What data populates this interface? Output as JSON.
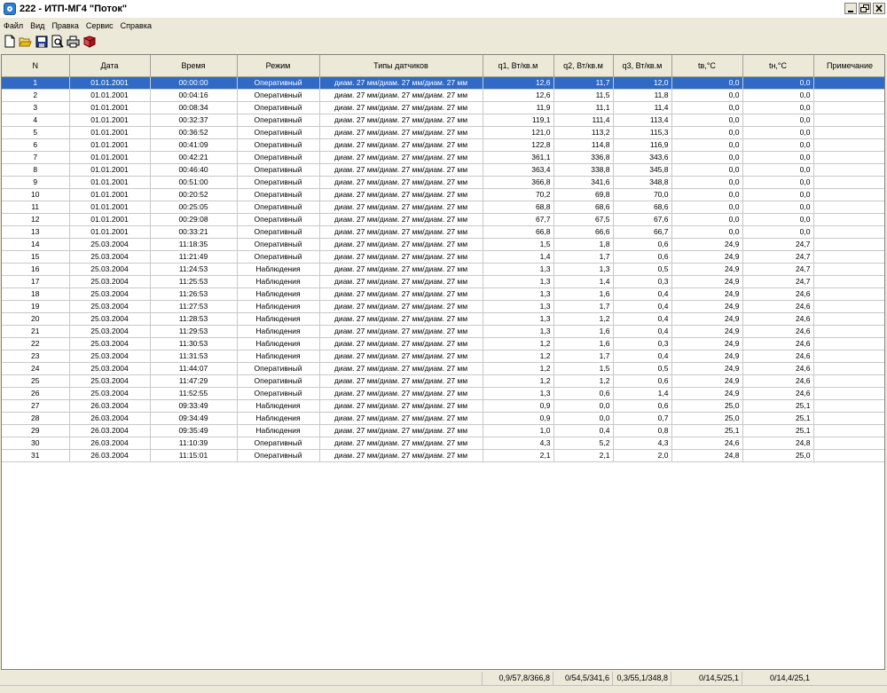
{
  "window": {
    "title": "222 - ИТП-МГ4 \"Поток\""
  },
  "menu": [
    "Файл",
    "Вид",
    "Правка",
    "Сервис",
    "Справка"
  ],
  "toolbar": [
    {
      "name": "new-document-icon"
    },
    {
      "name": "open-folder-icon"
    },
    {
      "name": "save-icon"
    },
    {
      "name": "print-preview-icon"
    },
    {
      "name": "print-icon"
    },
    {
      "name": "help-book-icon"
    }
  ],
  "table": {
    "columns": [
      "N",
      "Дата",
      "Время",
      "Режим",
      "Типы датчиков",
      "q1, Вт/кв.м",
      "q2, Вт/кв.м",
      "q3, Вт/кв.м",
      "tв,°C",
      "tн,°C",
      "Примечание"
    ],
    "selected_row": 0,
    "rows": [
      [
        "1",
        "01.01.2001",
        "00:00:00",
        "Оперативный",
        "диам. 27 мм/диам. 27 мм/диам. 27 мм",
        "12,6",
        "11,7",
        "12,0",
        "0,0",
        "0,0",
        ""
      ],
      [
        "2",
        "01.01.2001",
        "00:04:16",
        "Оперативный",
        "диам. 27 мм/диам. 27 мм/диам. 27 мм",
        "12,6",
        "11,5",
        "11,8",
        "0,0",
        "0,0",
        ""
      ],
      [
        "3",
        "01.01.2001",
        "00:08:34",
        "Оперативный",
        "диам. 27 мм/диам. 27 мм/диам. 27 мм",
        "11,9",
        "11,1",
        "11,4",
        "0,0",
        "0,0",
        ""
      ],
      [
        "4",
        "01.01.2001",
        "00:32:37",
        "Оперативный",
        "диам. 27 мм/диам. 27 мм/диам. 27 мм",
        "119,1",
        "111,4",
        "113,4",
        "0,0",
        "0,0",
        ""
      ],
      [
        "5",
        "01.01.2001",
        "00:36:52",
        "Оперативный",
        "диам. 27 мм/диам. 27 мм/диам. 27 мм",
        "121,0",
        "113,2",
        "115,3",
        "0,0",
        "0,0",
        ""
      ],
      [
        "6",
        "01.01.2001",
        "00:41:09",
        "Оперативный",
        "диам. 27 мм/диам. 27 мм/диам. 27 мм",
        "122,8",
        "114,8",
        "116,9",
        "0,0",
        "0,0",
        ""
      ],
      [
        "7",
        "01.01.2001",
        "00:42:21",
        "Оперативный",
        "диам. 27 мм/диам. 27 мм/диам. 27 мм",
        "361,1",
        "336,8",
        "343,6",
        "0,0",
        "0,0",
        ""
      ],
      [
        "8",
        "01.01.2001",
        "00:46:40",
        "Оперативный",
        "диам. 27 мм/диам. 27 мм/диам. 27 мм",
        "363,4",
        "338,8",
        "345,8",
        "0,0",
        "0,0",
        ""
      ],
      [
        "9",
        "01.01.2001",
        "00:51:00",
        "Оперативный",
        "диам. 27 мм/диам. 27 мм/диам. 27 мм",
        "366,8",
        "341,6",
        "348,8",
        "0,0",
        "0,0",
        ""
      ],
      [
        "10",
        "01.01.2001",
        "00:20:52",
        "Оперативный",
        "диам. 27 мм/диам. 27 мм/диам. 27 мм",
        "70,2",
        "69,8",
        "70,0",
        "0,0",
        "0,0",
        ""
      ],
      [
        "11",
        "01.01.2001",
        "00:25:05",
        "Оперативный",
        "диам. 27 мм/диам. 27 мм/диам. 27 мм",
        "68,8",
        "68,6",
        "68,6",
        "0,0",
        "0,0",
        ""
      ],
      [
        "12",
        "01.01.2001",
        "00:29:08",
        "Оперативный",
        "диам. 27 мм/диам. 27 мм/диам. 27 мм",
        "67,7",
        "67,5",
        "67,6",
        "0,0",
        "0,0",
        ""
      ],
      [
        "13",
        "01.01.2001",
        "00:33:21",
        "Оперативный",
        "диам. 27 мм/диам. 27 мм/диам. 27 мм",
        "66,8",
        "66,6",
        "66,7",
        "0,0",
        "0,0",
        ""
      ],
      [
        "14",
        "25.03.2004",
        "11:18:35",
        "Оперативный",
        "диам. 27 мм/диам. 27 мм/диам. 27 мм",
        "1,5",
        "1,8",
        "0,6",
        "24,9",
        "24,7",
        ""
      ],
      [
        "15",
        "25.03.2004",
        "11:21:49",
        "Оперативный",
        "диам. 27 мм/диам. 27 мм/диам. 27 мм",
        "1,4",
        "1,7",
        "0,6",
        "24,9",
        "24,7",
        ""
      ],
      [
        "16",
        "25.03.2004",
        "11:24:53",
        "Наблюдения",
        "диам. 27 мм/диам. 27 мм/диам. 27 мм",
        "1,3",
        "1,3",
        "0,5",
        "24,9",
        "24,7",
        ""
      ],
      [
        "17",
        "25.03.2004",
        "11:25:53",
        "Наблюдения",
        "диам. 27 мм/диам. 27 мм/диам. 27 мм",
        "1,3",
        "1,4",
        "0,3",
        "24,9",
        "24,7",
        ""
      ],
      [
        "18",
        "25.03.2004",
        "11:26:53",
        "Наблюдения",
        "диам. 27 мм/диам. 27 мм/диам. 27 мм",
        "1,3",
        "1,6",
        "0,4",
        "24,9",
        "24,6",
        ""
      ],
      [
        "19",
        "25.03.2004",
        "11:27:53",
        "Наблюдения",
        "диам. 27 мм/диам. 27 мм/диам. 27 мм",
        "1,3",
        "1,7",
        "0,4",
        "24,9",
        "24,6",
        ""
      ],
      [
        "20",
        "25.03.2004",
        "11:28:53",
        "Наблюдения",
        "диам. 27 мм/диам. 27 мм/диам. 27 мм",
        "1,3",
        "1,2",
        "0,4",
        "24,9",
        "24,6",
        ""
      ],
      [
        "21",
        "25.03.2004",
        "11:29:53",
        "Наблюдения",
        "диам. 27 мм/диам. 27 мм/диам. 27 мм",
        "1,3",
        "1,6",
        "0,4",
        "24,9",
        "24,6",
        ""
      ],
      [
        "22",
        "25.03.2004",
        "11:30:53",
        "Наблюдения",
        "диам. 27 мм/диам. 27 мм/диам. 27 мм",
        "1,2",
        "1,6",
        "0,3",
        "24,9",
        "24,6",
        ""
      ],
      [
        "23",
        "25.03.2004",
        "11:31:53",
        "Наблюдения",
        "диам. 27 мм/диам. 27 мм/диам. 27 мм",
        "1,2",
        "1,7",
        "0,4",
        "24,9",
        "24,6",
        ""
      ],
      [
        "24",
        "25.03.2004",
        "11:44:07",
        "Оперативный",
        "диам. 27 мм/диам. 27 мм/диам. 27 мм",
        "1,2",
        "1,5",
        "0,5",
        "24,9",
        "24,6",
        ""
      ],
      [
        "25",
        "25.03.2004",
        "11:47:29",
        "Оперативный",
        "диам. 27 мм/диам. 27 мм/диам. 27 мм",
        "1,2",
        "1,2",
        "0,6",
        "24,9",
        "24,6",
        ""
      ],
      [
        "26",
        "25.03.2004",
        "11:52:55",
        "Оперативный",
        "диам. 27 мм/диам. 27 мм/диам. 27 мм",
        "1,3",
        "0,6",
        "1,4",
        "24,9",
        "24,6",
        ""
      ],
      [
        "27",
        "26.03.2004",
        "09:33:49",
        "Наблюдения",
        "диам. 27 мм/диам. 27 мм/диам. 27 мм",
        "0,9",
        "0,0",
        "0,6",
        "25,0",
        "25,1",
        ""
      ],
      [
        "28",
        "26.03.2004",
        "09:34:49",
        "Наблюдения",
        "диам. 27 мм/диам. 27 мм/диам. 27 мм",
        "0,9",
        "0,0",
        "0,7",
        "25,0",
        "25,1",
        ""
      ],
      [
        "29",
        "26.03.2004",
        "09:35:49",
        "Наблюдения",
        "диам. 27 мм/диам. 27 мм/диам. 27 мм",
        "1,0",
        "0,4",
        "0,8",
        "25,1",
        "25,1",
        ""
      ],
      [
        "30",
        "26.03.2004",
        "11:10:39",
        "Оперативный",
        "диам. 27 мм/диам. 27 мм/диам. 27 мм",
        "4,3",
        "5,2",
        "4,3",
        "24,6",
        "24,8",
        ""
      ],
      [
        "31",
        "26.03.2004",
        "11:15:01",
        "Оперативный",
        "диам. 27 мм/диам. 27 мм/диам. 27 мм",
        "2,1",
        "2,1",
        "2,0",
        "24,8",
        "25,0",
        ""
      ]
    ]
  },
  "status": {
    "q1": "0,9/57,8/366,8",
    "q2": "0/54,5/341,6",
    "q3": "0,3/55,1/348,8",
    "tv": "0/14,5/25,1",
    "tn": "0/14,4/25,1"
  },
  "colors": {
    "selection": "#316ac5",
    "chrome": "#ece9d8"
  }
}
